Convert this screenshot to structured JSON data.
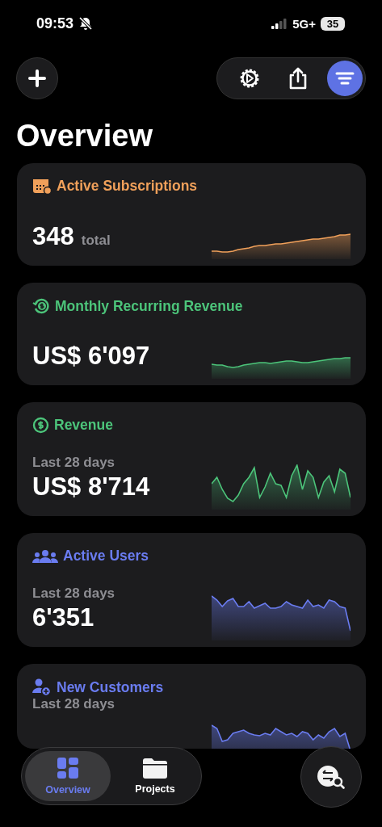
{
  "status_bar": {
    "time": "09:53",
    "network": "5G+",
    "battery": "35"
  },
  "title": "Overview",
  "cards": [
    {
      "title": "Active Subscriptions",
      "color": "#f0a05a",
      "value": "348",
      "unit": "total"
    },
    {
      "title": "Monthly Recurring Revenue",
      "color": "#4cc47a",
      "value": "US$ 6'097"
    },
    {
      "title": "Revenue",
      "color": "#4cc47a",
      "subtitle": "Last 28 days",
      "value": "US$ 8'714"
    },
    {
      "title": "Active Users",
      "color": "#6a7cf0",
      "subtitle": "Last 28 days",
      "value": "6'351"
    },
    {
      "title": "New Customers",
      "color": "#6a7cf0",
      "subtitle": "Last 28 days"
    }
  ],
  "tabs": [
    {
      "label": "Overview",
      "selected": true
    },
    {
      "label": "Projects",
      "selected": false
    }
  ]
}
